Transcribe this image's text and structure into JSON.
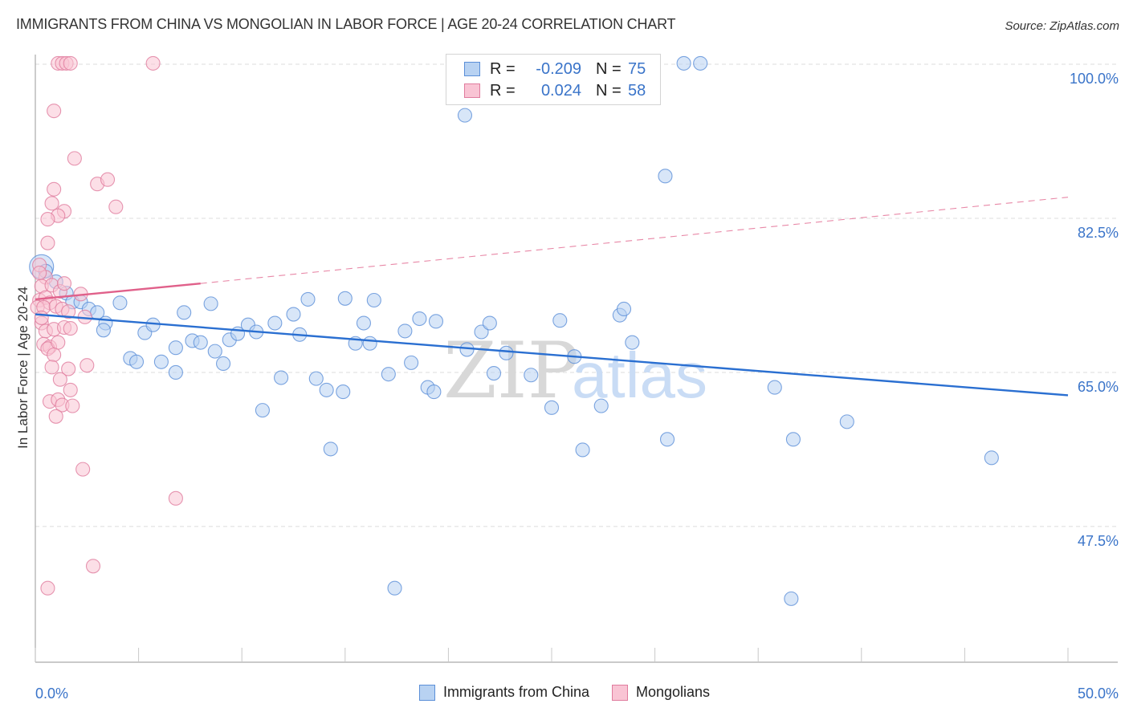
{
  "header": {
    "title": "IMMIGRANTS FROM CHINA VS MONGOLIAN IN LABOR FORCE | AGE 20-24 CORRELATION CHART",
    "source": "Source: ZipAtlas.com"
  },
  "watermark": {
    "zip": "ZIP",
    "atlas": "atlas"
  },
  "colors": {
    "blue_fill": "#b8d2f2",
    "blue_stroke": "#5b8fd8",
    "blue_line": "#2a6fd1",
    "pink_fill": "#f9c4d4",
    "pink_stroke": "#e07c9e",
    "pink_line": "#e0608a",
    "axis_label": "#3a74c9"
  },
  "legend": {
    "rows": [
      {
        "r_label": "R =",
        "r_value": "-0.209",
        "n_label": "N =",
        "n_value": "75"
      },
      {
        "r_label": "R =",
        "r_value": "0.024",
        "n_label": "N =",
        "n_value": "58"
      }
    ]
  },
  "bottom_legend": [
    {
      "label": "Immigrants from China"
    },
    {
      "label": "Mongolians"
    }
  ],
  "chart_data": {
    "type": "scatter",
    "title": "IMMIGRANTS FROM CHINA VS MONGOLIAN IN LABOR FORCE | AGE 20-24 CORRELATION CHART",
    "xlabel": "",
    "ylabel": "In Labor Force | Age 20-24",
    "xlim": [
      0,
      50
    ],
    "ylim": [
      31,
      103
    ],
    "x_tick_labels": [
      {
        "value": 0,
        "label": "0.0%"
      },
      {
        "value": 50,
        "label": "50.0%"
      }
    ],
    "x_minor_ticks": [
      0,
      5,
      10,
      15,
      20,
      25,
      30,
      35,
      40,
      45,
      50
    ],
    "y_tick_labels": [
      {
        "value": 100,
        "label": "100.0%"
      },
      {
        "value": 82.5,
        "label": "82.5%"
      },
      {
        "value": 65,
        "label": "65.0%"
      },
      {
        "value": 47.5,
        "label": "47.5%"
      }
    ],
    "grid": "horizontal-dashed",
    "legend_position": "top-center",
    "series": [
      {
        "name": "Immigrants from China",
        "color": "blue",
        "r": -0.209,
        "n": 75,
        "trend": {
          "x": [
            0,
            50
          ],
          "y": [
            71.6,
            62.4
          ],
          "style": "solid"
        },
        "points": [
          [
            0.3,
            77.0,
            "big"
          ],
          [
            0.5,
            76.5
          ],
          [
            1.0,
            75.3
          ],
          [
            1.5,
            74.0
          ],
          [
            1.8,
            73.0
          ],
          [
            2.2,
            73.0
          ],
          [
            2.6,
            72.2
          ],
          [
            3.0,
            71.8
          ],
          [
            3.4,
            70.6
          ],
          [
            3.3,
            69.8
          ],
          [
            4.1,
            72.9
          ],
          [
            4.6,
            66.6
          ],
          [
            4.9,
            66.2
          ],
          [
            5.3,
            69.5
          ],
          [
            5.7,
            70.4
          ],
          [
            6.1,
            66.2
          ],
          [
            6.8,
            65.0
          ],
          [
            6.8,
            67.8
          ],
          [
            7.2,
            71.8
          ],
          [
            7.6,
            68.6
          ],
          [
            8.0,
            68.4
          ],
          [
            8.5,
            72.8
          ],
          [
            8.7,
            67.4
          ],
          [
            9.1,
            66.0
          ],
          [
            9.4,
            68.7
          ],
          [
            9.8,
            69.4
          ],
          [
            10.3,
            70.4
          ],
          [
            10.7,
            69.6
          ],
          [
            11.0,
            60.7
          ],
          [
            11.6,
            70.6
          ],
          [
            11.9,
            64.4
          ],
          [
            12.5,
            71.6
          ],
          [
            12.8,
            69.3
          ],
          [
            13.2,
            73.3
          ],
          [
            13.6,
            64.3
          ],
          [
            14.1,
            63.0
          ],
          [
            14.3,
            56.3
          ],
          [
            14.9,
            62.8
          ],
          [
            15.0,
            73.4
          ],
          [
            15.5,
            68.3
          ],
          [
            15.9,
            70.6
          ],
          [
            16.2,
            68.3
          ],
          [
            16.4,
            73.2
          ],
          [
            17.1,
            64.8
          ],
          [
            17.4,
            40.5
          ],
          [
            17.9,
            69.7
          ],
          [
            18.2,
            66.1
          ],
          [
            18.6,
            71.1
          ],
          [
            19.0,
            63.3
          ],
          [
            19.3,
            62.8
          ],
          [
            19.4,
            70.8
          ],
          [
            20.8,
            94.2
          ],
          [
            20.9,
            67.6
          ],
          [
            21.6,
            69.6
          ],
          [
            22.0,
            70.6
          ],
          [
            22.2,
            64.9
          ],
          [
            22.8,
            67.2
          ],
          [
            24.0,
            64.7
          ],
          [
            25.0,
            61.0
          ],
          [
            25.4,
            70.9
          ],
          [
            26.1,
            66.8
          ],
          [
            26.5,
            56.2
          ],
          [
            27.4,
            61.2
          ],
          [
            28.3,
            71.5
          ],
          [
            28.5,
            72.2
          ],
          [
            28.9,
            68.4
          ],
          [
            30.5,
            87.3
          ],
          [
            30.6,
            57.4
          ],
          [
            31.4,
            100.1
          ],
          [
            32.2,
            100.1
          ],
          [
            35.8,
            63.3
          ],
          [
            36.7,
            57.4
          ],
          [
            36.6,
            39.3
          ],
          [
            39.3,
            59.4
          ],
          [
            46.3,
            55.3
          ]
        ]
      },
      {
        "name": "Mongolians",
        "color": "pink",
        "r": 0.024,
        "n": 58,
        "trend": {
          "x": [
            0,
            8
          ],
          "y": [
            73.3,
            75.1
          ],
          "style": "solid",
          "extension": {
            "x": [
              8,
              50
            ],
            "y": [
              75.1,
              84.9
            ],
            "style": "dashed"
          }
        },
        "points": [
          [
            1.1,
            100.1
          ],
          [
            1.3,
            100.1
          ],
          [
            1.5,
            100.1
          ],
          [
            1.7,
            100.1
          ],
          [
            5.7,
            100.1
          ],
          [
            0.9,
            94.7
          ],
          [
            1.9,
            89.3
          ],
          [
            0.9,
            85.8
          ],
          [
            3.0,
            86.4
          ],
          [
            3.5,
            86.9
          ],
          [
            0.8,
            84.2
          ],
          [
            1.4,
            83.3
          ],
          [
            3.9,
            83.8
          ],
          [
            1.1,
            82.8
          ],
          [
            0.6,
            82.4
          ],
          [
            0.6,
            79.7
          ],
          [
            0.2,
            77.2
          ],
          [
            0.5,
            75.8
          ],
          [
            0.3,
            74.8
          ],
          [
            0.8,
            74.9
          ],
          [
            1.2,
            74.2
          ],
          [
            1.4,
            75.1
          ],
          [
            2.2,
            73.9
          ],
          [
            0.2,
            73.2
          ],
          [
            0.5,
            73.5
          ],
          [
            0.7,
            72.9
          ],
          [
            0.1,
            72.4
          ],
          [
            0.4,
            72.4
          ],
          [
            1.0,
            72.5
          ],
          [
            1.3,
            72.2
          ],
          [
            1.6,
            71.9
          ],
          [
            2.4,
            71.3
          ],
          [
            0.3,
            70.6
          ],
          [
            0.5,
            69.7
          ],
          [
            0.9,
            69.9
          ],
          [
            1.4,
            70.1
          ],
          [
            1.7,
            70.0
          ],
          [
            0.4,
            68.2
          ],
          [
            0.7,
            67.9
          ],
          [
            0.6,
            67.7
          ],
          [
            1.1,
            68.4
          ],
          [
            0.9,
            67.0
          ],
          [
            0.8,
            65.6
          ],
          [
            1.6,
            65.4
          ],
          [
            2.5,
            65.8
          ],
          [
            1.2,
            64.2
          ],
          [
            1.7,
            63.0
          ],
          [
            0.7,
            61.7
          ],
          [
            1.1,
            61.9
          ],
          [
            1.3,
            61.3
          ],
          [
            1.8,
            61.2
          ],
          [
            1.0,
            60.0
          ],
          [
            2.3,
            54.0
          ],
          [
            6.8,
            50.7
          ],
          [
            2.8,
            43.0
          ],
          [
            0.6,
            40.5
          ],
          [
            0.2,
            76.3
          ],
          [
            0.3,
            71.2
          ]
        ]
      }
    ]
  }
}
